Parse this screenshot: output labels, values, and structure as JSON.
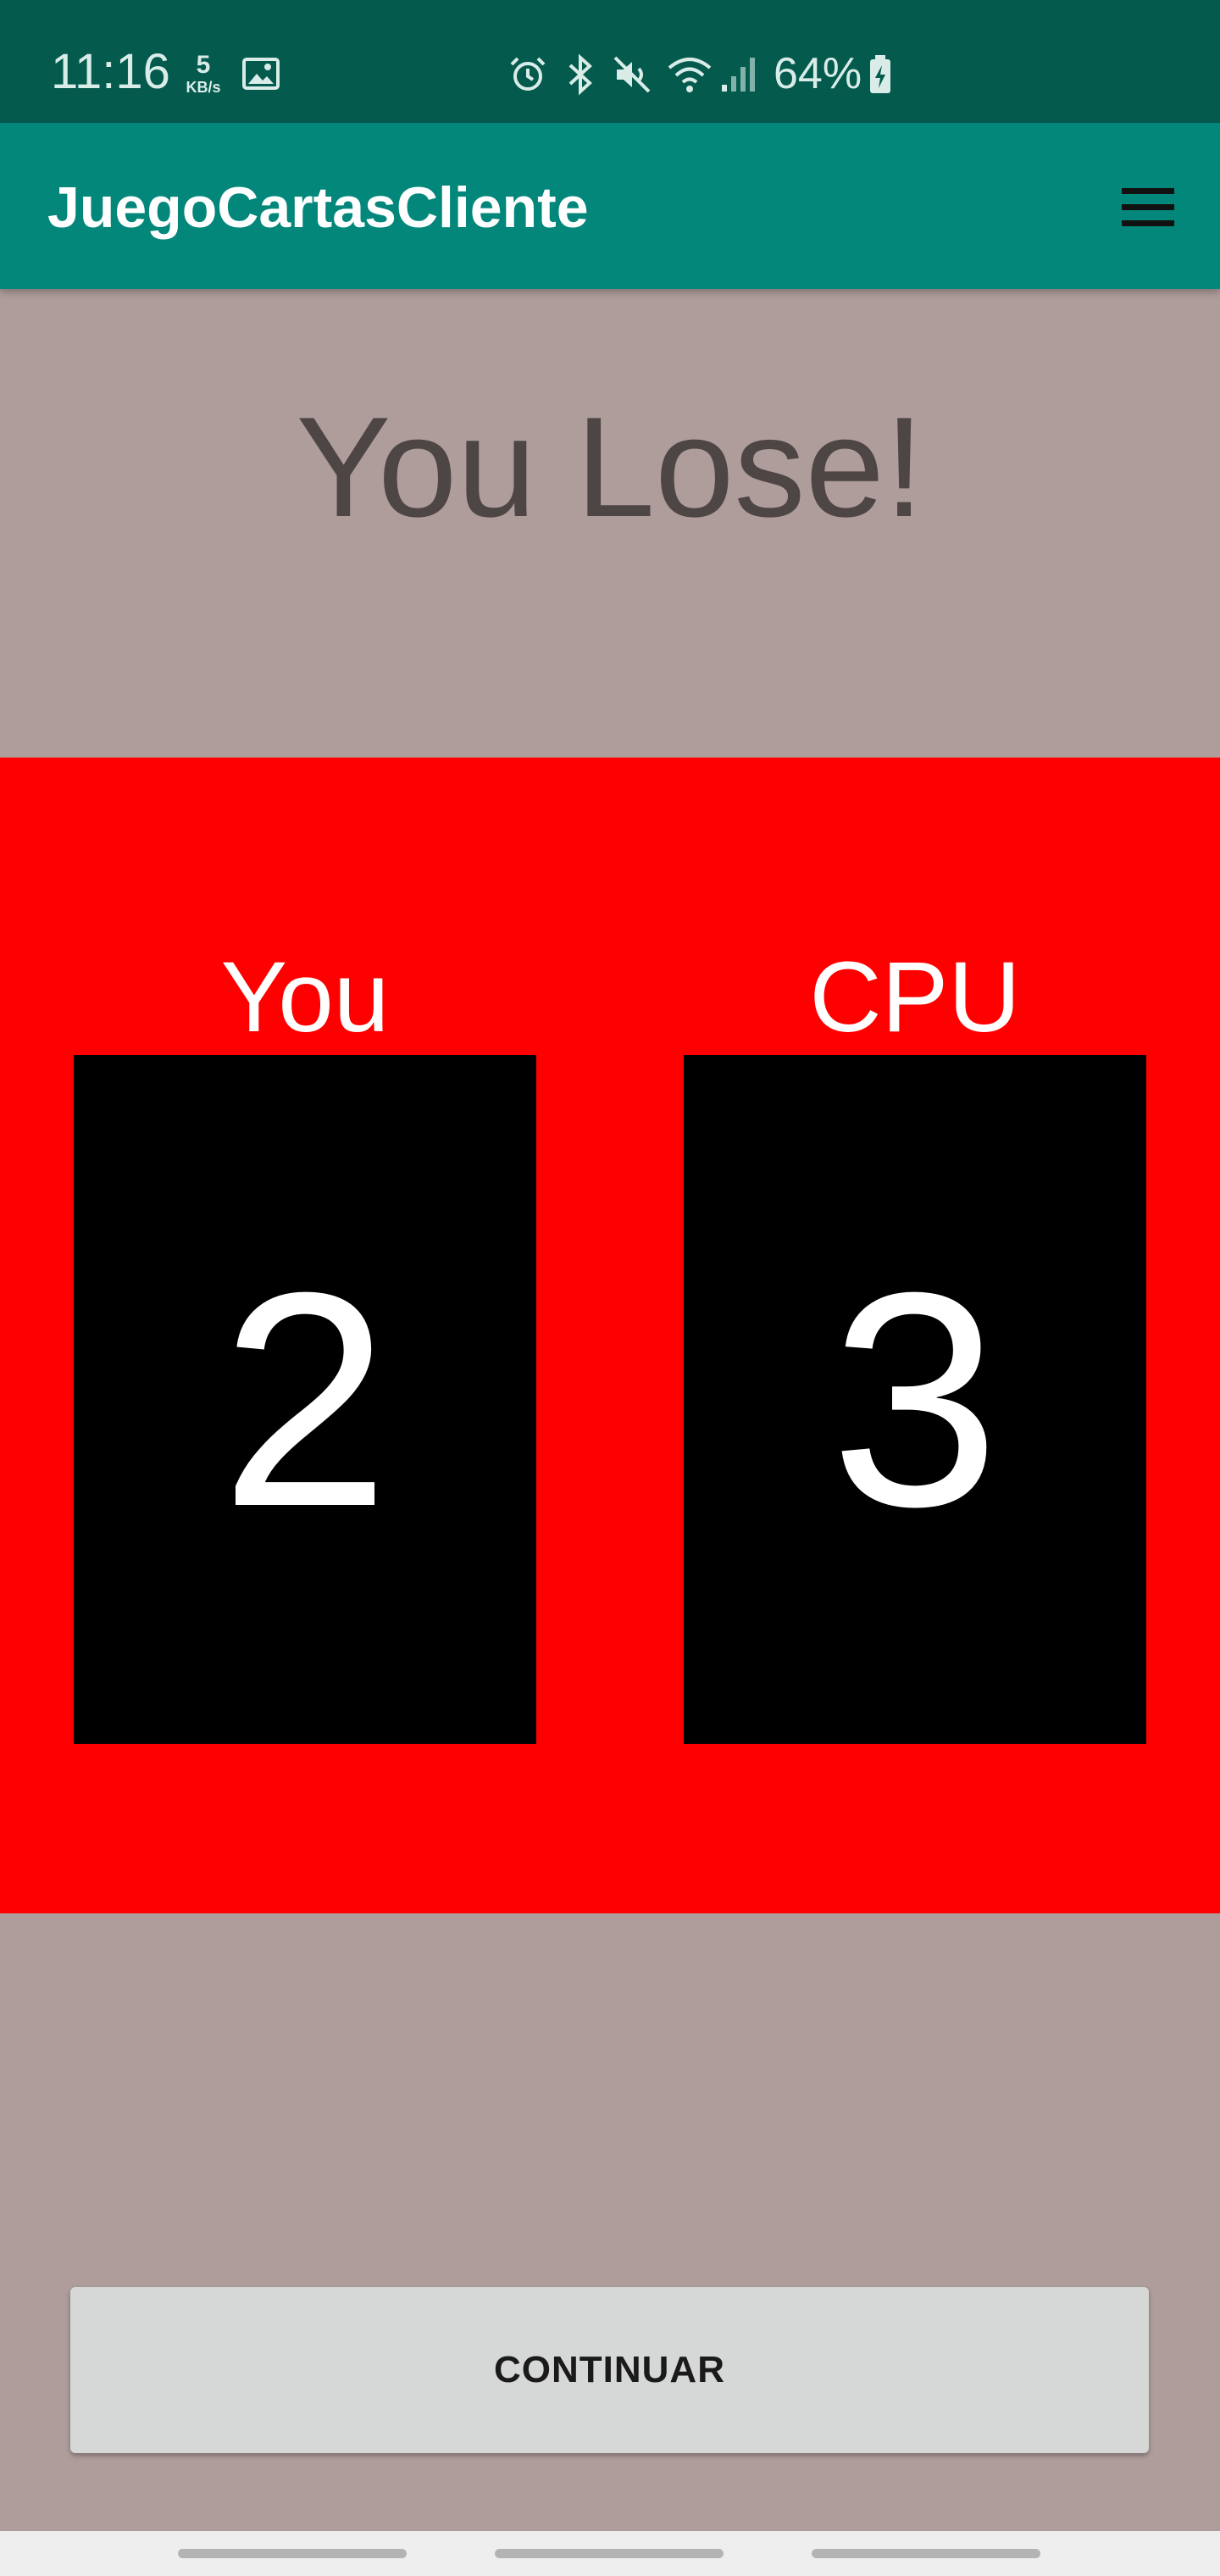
{
  "status_bar": {
    "time": "11:16",
    "net_speed_value": "5",
    "net_speed_unit": "KB/s",
    "battery_percent": "64%",
    "icons": [
      "gallery-icon",
      "alarm-icon",
      "bluetooth-icon",
      "mute-icon",
      "wifi-icon",
      "signal-icon",
      "battery-charging-icon"
    ]
  },
  "app_bar": {
    "title": "JuegoCartasCliente",
    "menu_icon": "hamburger-menu-icon"
  },
  "result": {
    "text": "You Lose!"
  },
  "game": {
    "player": {
      "label": "You",
      "card_value": "2"
    },
    "cpu": {
      "label": "CPU",
      "card_value": "3"
    }
  },
  "actions": {
    "continue_label": "CONTINUAR"
  },
  "colors": {
    "status_bar": "#035a4d",
    "app_bar": "#02877a",
    "background": "#ae9d9b",
    "game_panel": "#ff0000",
    "card": "#000000",
    "button": "#d6d7d7"
  }
}
